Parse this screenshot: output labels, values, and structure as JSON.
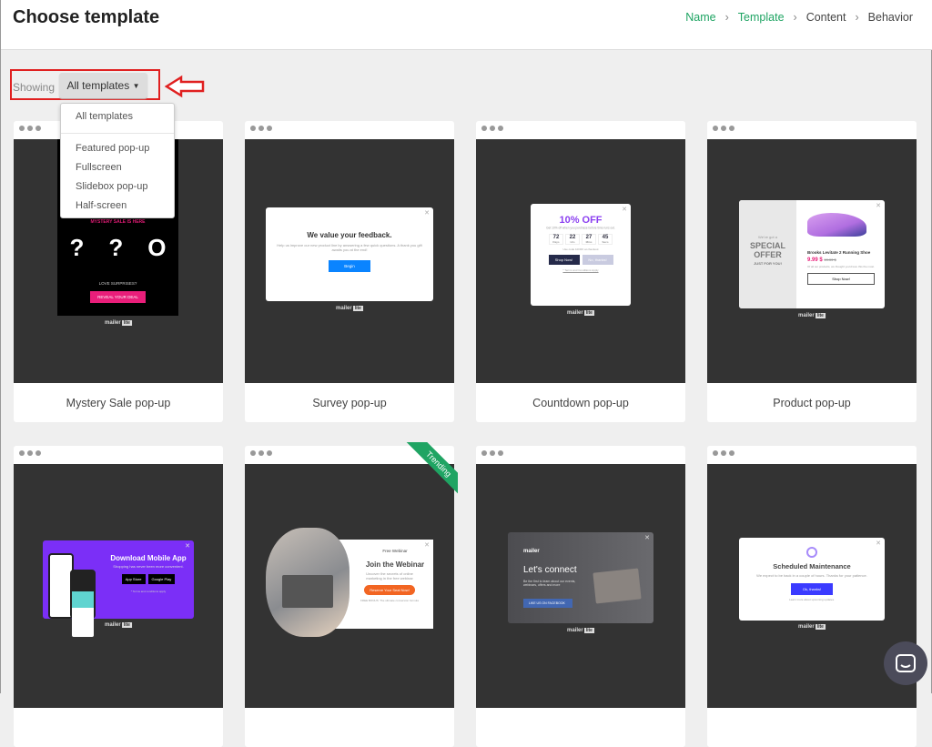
{
  "header": {
    "title": "Choose template",
    "breadcrumb": [
      "Name",
      "Template",
      "Content",
      "Behavior"
    ]
  },
  "filter": {
    "label": "Showing",
    "selected": "All templates",
    "options": [
      "All templates",
      "Featured pop-up",
      "Fullscreen",
      "Slidebox pop-up",
      "Half-screen"
    ]
  },
  "cards": [
    {
      "name": "Mystery Sale pop-up",
      "p": {
        "head": "MYSTERY SALE IS HERE",
        "chars": [
          "?",
          "?",
          "O"
        ],
        "sub": "LOVE SURPRISES?",
        "btn": "REVEAL YOUR DEAL"
      }
    },
    {
      "name": "Survey pop-up",
      "p": {
        "head": "We value your feedback.",
        "sub": "Help us improve our new product line by answering a few quick questions. A thank you gift awaits you at the end!",
        "btn": "Begin"
      }
    },
    {
      "name": "Countdown pop-up",
      "p": {
        "head": "10% OFF",
        "sub": "Get 10% off when you purchase before time runs out.",
        "nums": [
          "72",
          "22",
          "27",
          "45"
        ],
        "units": [
          "Days",
          "Hrs",
          "Mins",
          "Secs"
        ],
        "code": "Use code 10OFF at checkout",
        "btn": "Shop Now!",
        "btn2": "No, thanks!",
        "terms": "* Terms and Conditions Apply"
      }
    },
    {
      "name": "Product pop-up",
      "p": {
        "pre": "We've got a",
        "head": "SPECIAL OFFER",
        "sub": "JUST FOR YOU!",
        "product": "Brooks Levitate 2 Running Shoe",
        "price": "9.99 $",
        "old": "19.99 $",
        "desc": "Of all our products, we thought you'd love this the most.",
        "btn": "Shop Now!"
      }
    },
    {
      "name": "",
      "p": {
        "head": "Download Mobile App",
        "sub": "Shopping has never been more convenient.",
        "b1": "App Store",
        "b2": "Google Play",
        "terms": "* Terms and conditions apply"
      }
    },
    {
      "name": "",
      "badge": "Trending",
      "p": {
        "pre": "Free Webinar",
        "head": "Join the Webinar",
        "sub": "Uncover the secrets of online marketing in the free webinar",
        "btn": "Reserve Your Seat Now!",
        "bonus": "FREE BONUS: The ultimate conversion formula"
      }
    },
    {
      "name": "",
      "p": {
        "logo": "mailer",
        "head": "Let's connect",
        "sub": "Be the first to learn about our events, webinars, offers and more",
        "btn": "LIKE US ON FACEBOOK"
      }
    },
    {
      "name": "",
      "p": {
        "head": "Scheduled Maintenance",
        "sub": "We expect to be back in a couple of hours. Thanks for your patience.",
        "btn": "Ok, thanks!",
        "link": "Learn more about upcoming updates."
      }
    }
  ],
  "branding": {
    "powered": "powered by",
    "logo": "mailer",
    "tag": "lite"
  },
  "colors": {
    "accent": "#1fa463",
    "highlight": "#e02020",
    "preview_bg": "#333333"
  }
}
